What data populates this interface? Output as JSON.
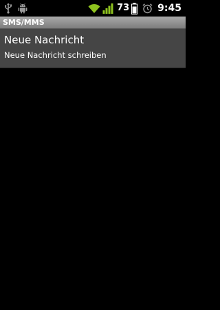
{
  "status_bar": {
    "notification_icons": [
      "usb-icon",
      "android-debug-icon"
    ],
    "system_icons": [
      "wifi-icon",
      "signal-icon",
      "battery-icon",
      "alarm-icon"
    ],
    "battery_level": "73",
    "time": "9:45",
    "colors": {
      "signal_green": "#8fc31f",
      "icon_gray": "#9a9a9a"
    }
  },
  "title_bar": {
    "title": "SMS/MMS"
  },
  "list": {
    "items": [
      {
        "title": "Neue Nachricht",
        "subtitle": "Neue Nachricht schreiben"
      }
    ]
  },
  "colors": {
    "background": "#000000",
    "list_item_background": "#454545",
    "title_bar_top": "#a9a9a9",
    "title_bar_bottom": "#7d7d7d"
  }
}
